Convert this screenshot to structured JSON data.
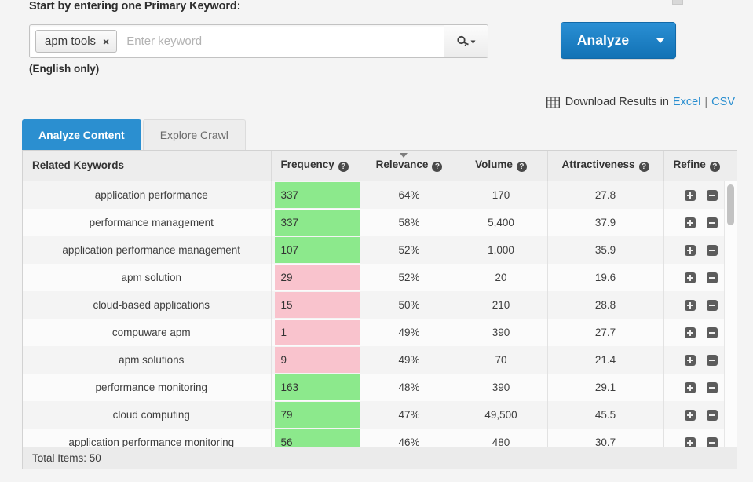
{
  "prompt": {
    "label": "Start by entering one Primary Keyword:",
    "language_note": "(English only)"
  },
  "keyword_input": {
    "chip_label": "apm tools",
    "chip_remove": "×",
    "placeholder": "Enter keyword",
    "value": "",
    "search_icon": "key-search-icon"
  },
  "analyze": {
    "label": "Analyze",
    "caret_icon": "chevron-down-icon",
    "color": "#2b8fd0"
  },
  "download": {
    "grid_icon": "table-grid-icon",
    "text": "Download Results in",
    "excel": "Excel",
    "separator": "|",
    "csv": "CSV",
    "link_color": "#2b8fd0"
  },
  "tabs": [
    {
      "label": "Analyze Content",
      "active": true
    },
    {
      "label": "Explore Crawl",
      "active": false
    }
  ],
  "table": {
    "columns": [
      {
        "key": "keyword",
        "label": "Related Keywords",
        "help": true,
        "sorted": false,
        "align": "left"
      },
      {
        "key": "frequency",
        "label": "Frequency",
        "help": true,
        "sorted": false,
        "align": "left"
      },
      {
        "key": "relevance",
        "label": "Relevance",
        "help": true,
        "sorted": true,
        "align": "center"
      },
      {
        "key": "volume",
        "label": "Volume",
        "help": true,
        "sorted": false,
        "align": "center"
      },
      {
        "key": "attractiveness",
        "label": "Attractiveness",
        "help": true,
        "sorted": false,
        "align": "center"
      },
      {
        "key": "refine",
        "label": "Refine",
        "help": true,
        "sorted": false,
        "align": "center"
      }
    ],
    "help_glyph": "?",
    "sort_column": "Relevance",
    "sort_direction": "desc",
    "rows": [
      {
        "keyword": "application performance",
        "frequency": "337",
        "freq_color": "green",
        "relevance": "64%",
        "volume": "170",
        "attractiveness": "27.8"
      },
      {
        "keyword": "performance management",
        "frequency": "337",
        "freq_color": "green",
        "relevance": "58%",
        "volume": "5,400",
        "attractiveness": "37.9"
      },
      {
        "keyword": "application performance management",
        "frequency": "107",
        "freq_color": "green",
        "relevance": "52%",
        "volume": "1,000",
        "attractiveness": "35.9"
      },
      {
        "keyword": "apm solution",
        "frequency": "29",
        "freq_color": "pink",
        "relevance": "52%",
        "volume": "20",
        "attractiveness": "19.6"
      },
      {
        "keyword": "cloud-based applications",
        "frequency": "15",
        "freq_color": "pink",
        "relevance": "50%",
        "volume": "210",
        "attractiveness": "28.8"
      },
      {
        "keyword": "compuware apm",
        "frequency": "1",
        "freq_color": "pink",
        "relevance": "49%",
        "volume": "390",
        "attractiveness": "27.7"
      },
      {
        "keyword": "apm solutions",
        "frequency": "9",
        "freq_color": "pink",
        "relevance": "49%",
        "volume": "70",
        "attractiveness": "21.4"
      },
      {
        "keyword": "performance monitoring",
        "frequency": "163",
        "freq_color": "green",
        "relevance": "48%",
        "volume": "390",
        "attractiveness": "29.1"
      },
      {
        "keyword": "cloud computing",
        "frequency": "79",
        "freq_color": "green",
        "relevance": "47%",
        "volume": "49,500",
        "attractiveness": "45.5"
      },
      {
        "keyword": "application performance monitoring",
        "frequency": "56",
        "freq_color": "green",
        "relevance": "46%",
        "volume": "480",
        "attractiveness": "30.7"
      }
    ],
    "refine_add_icon": "plus-square-icon",
    "refine_remove_icon": "minus-square-icon",
    "footer": "Total Items: 50"
  },
  "colors": {
    "accent_blue": "#2b8fd0",
    "freq_green": "#8ce98c",
    "freq_pink": "#f9c3cd",
    "page_bg": "#f4f4f4"
  }
}
